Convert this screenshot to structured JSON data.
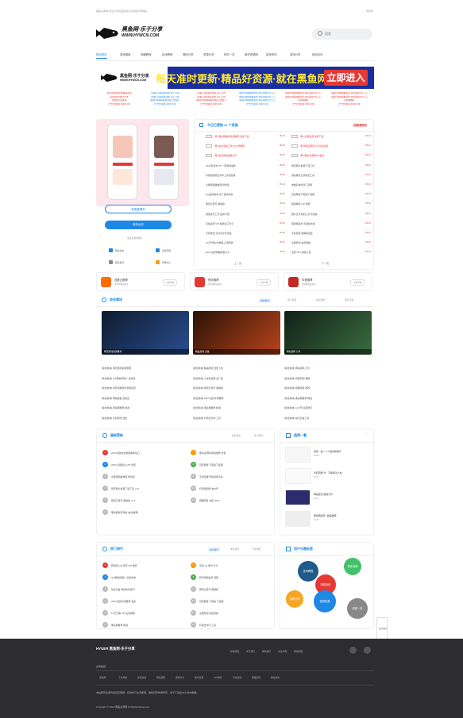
{
  "topbar": {
    "left": "黑鱼资源网-专注分享优质资源与实用技巧的网站",
    "right": "手机版"
  },
  "logo": {
    "brand": "黑鱼网·乐于分享",
    "url": "WWW.HYWCN.COM"
  },
  "search": {
    "placeholder": "搜索"
  },
  "nav": [
    "网站首页",
    "游戏模板",
    "网赚教程",
    "技术教程",
    "源码分享",
    "资源分享",
    "软件一览",
    "素材资源网",
    "影视资讯",
    "游戏分享",
    "网站优化"
  ],
  "banner": {
    "text": "每天准时更新·精品好资源·就在黑鱼网",
    "button": "立即进入"
  },
  "adlinks": [
    [
      "黑鱼资源网[付费]精品资源",
      "[赞助] 全站资源免费 四人可用",
      "[赞助] 全站资源免费 四人可用",
      "[赞助] 网站模板免费 源码资源分享入口",
      "[赞助] 网站模板免费 源码资源分享入口",
      "[赞助] 网站模板免费 源码资源分享入口",
      "黑鱼网推荐",
      "优惠活动 折扣领取入口"
    ],
    [
      "黑鱼网VIP会员年卡",
      "[赞助] 全站资源免费 四人可用",
      "[赞助] 全站资源免费 四人可用",
      "[赞助] 网站模板免费 源码资源分享入口",
      "[赞助] 网站模板免费 源码资源分享入口",
      "[赞助] 网站模板免费 源码资源分享入口",
      "黑鱼网推荐",
      "优惠活动 折扣领取入口"
    ],
    [
      "全网最大资源站",
      "[赞助] 网站模板资源站 点击进入",
      "[赞助] 网站模板资源站 点击进入",
      "[赞助] 网站模板免费 源码资源分享入口",
      "黑鱼网推荐",
      "黑鱼网推荐",
      "优惠活动 折扣领取入口",
      "优惠活动 折扣领取入口"
    ],
    [
      "[广告位]招租 3000元/年",
      "[广告位]招租 3000元/年",
      "[广告位]招租 3000元/年",
      "[广告位]招租 3000元/年",
      "[广告位]招租 3000元/年",
      "[广告位]招租 3000元/年",
      "[广告位]招租 3000元/年",
      "[广告位]招租 3000元/年"
    ]
  ],
  "sidebar_left": {
    "btn_login": "我是管理员",
    "btn_coop": "商务合作",
    "sub_label": "黑鱼资源网服务",
    "links": [
      "网站优化",
      "投稿须知",
      "联系我们",
      "招聘中心"
    ]
  },
  "today": {
    "title": "今日已更新 21 个资源",
    "more": "投稿请联系",
    "left": [
      {
        "text": "[荐] 黑鱼网精选资源推荐 合集下载",
        "date": "05-01",
        "red": true
      },
      {
        "text": "[荐] 站长必备工具大全 附教程",
        "date": "05-01",
        "red": true
      },
      {
        "text": "[荐] 最新网站模板分享",
        "date": "05-01",
        "red": true
      },
      {
        "text": "2020年最新 PS 一键调色插件",
        "date": "05-01",
        "red": false
      },
      {
        "text": "抖音短视频去水印工具免费版",
        "date": "05-01",
        "red": false
      },
      {
        "text": "全能视频播放器 绿色版",
        "date": "05-01",
        "red": false
      },
      {
        "text": "QQ最新版本 去广告纯净版",
        "date": "05-01",
        "red": false
      },
      {
        "text": "网易云音乐 解锁版",
        "date": "05-01",
        "red": false
      },
      {
        "text": "微信多开工具 最新可用",
        "date": "05-01",
        "red": false
      },
      {
        "text": "某站资源 VIP 解析接口分享",
        "date": "05-01",
        "red": false
      },
      {
        "text": "手机壁纸 高清无水印合集",
        "date": "05-01",
        "red": false
      },
      {
        "text": "10元开通VIP教程 亲测有效",
        "date": "05-01",
        "red": false
      },
      {
        "text": "2020 最新网赚项目分享",
        "date": "05-01",
        "red": false
      }
    ],
    "right": [
      {
        "text": "[荐] 全网资源 免费下载",
        "date": "05-01",
        "red": true
      },
      {
        "text": "[荐] 精品源码分享 站长必备",
        "date": "05-01",
        "red": true
      },
      {
        "text": "[荐] 黑鱼资源网VIP会员",
        "date": "05-01",
        "red": true
      },
      {
        "text": "网页图片批量下载工具",
        "date": "05-01",
        "red": false
      },
      {
        "text": "微信聊天记录恢复工具",
        "date": "05-01",
        "red": false
      },
      {
        "text": "电脑系统优化工具箱",
        "date": "05-01",
        "red": false
      },
      {
        "text": "百度网盘不限速下载器",
        "date": "05-01",
        "red": false
      },
      {
        "text": "超级解析 VIP 视频",
        "date": "05-01",
        "red": false
      },
      {
        "text": "图片文字识别工具 离线版",
        "date": "05-01",
        "red": false
      },
      {
        "text": "短视频素材 无版权合集",
        "date": "05-01",
        "red": false
      },
      {
        "text": "手机游戏 破解版合集",
        "date": "05-01",
        "red": false
      },
      {
        "text": "全网影视 免费观看",
        "date": "05-01",
        "red": false
      },
      {
        "text": "免费 PPT 模板下载",
        "date": "05-01",
        "red": false
      }
    ],
    "prev": "上一页",
    "next": "下一页"
  },
  "apps": [
    {
      "name": "百度云推荐",
      "sub": "黑鱼网精选推荐",
      "btn": "立即查看"
    },
    {
      "name": "快手推荐",
      "sub": "黑鱼网精选推荐",
      "btn": "立即查看"
    },
    {
      "name": "抖音推荐",
      "sub": "黑鱼网精选推荐",
      "btn": "立即查看"
    }
  ],
  "featured": {
    "title": "综合模块",
    "tabs": [
      "精选推荐",
      "热门资源",
      "最新发布",
      "更多分类"
    ],
    "thumbs": [
      "网页游戏资源推荐",
      "精品游戏 合集",
      "网站源码 分享"
    ],
    "cols": [
      [
        "[综合模块] 网页游戏资源推荐",
        "[综合模块] QQ群发机器人 最新版",
        "[综合模块] 免费领取腾讯视频会员",
        "[综合模块] 网站模板 自适应",
        "[综合模块] 黑鱼网推荐 精选",
        "[综合模块] 手机游戏 合集"
      ],
      [
        "[综合模块] 精品游戏 合集下载",
        "[综合模块] 小说阅读器 去广告",
        "[综合模块] 网易云音乐 解锁版",
        "[综合模块] 2020 最新手游推荐",
        "[综合模块] 黑鱼网推荐 精选",
        "[综合模块] 抖音去水印 工具"
      ],
      [
        "[综合模块] 网站源码 分享",
        "[综合模块] 视频剪辑 教程",
        "[综合模块] 网赚项目 推荐",
        "[综合模块] 黑鱼网推荐 精选",
        "[综合模块] 公众号 运营技巧",
        "[综合模块] 站长必备工具"
      ]
    ]
  },
  "latest": {
    "title": "最新更新",
    "tabs": [
      "最新更新",
      "热门推荐"
    ],
    "left": [
      "2020 最新在线视频解析接口",
      "2020 全网最全 VIP 影视",
      "全能视频播放器 绿色版",
      "网页图片批量下载工具 v2.0",
      "网易云音乐 解锁版 v1.5",
      "黑鱼网资源导航 [站长推荐]"
    ],
    "right": [
      "黑鱼资源网 精选推荐 合集",
      "百度网盘 不限速下载器",
      "王者荣耀 皮肤领取活动",
      "抖音短视频 去水印",
      "网赚项目 合集 2020"
    ]
  },
  "recommend": {
    "title": "值得一看",
    "items": [
      {
        "text": "自律，是一个人最好的修行",
        "date": "02-28"
      },
      {
        "text": "手机流量 卡，不够用怎么办",
        "date": "02-27"
      },
      {
        "text": "网站优化 经验分享",
        "date": "02-27"
      },
      {
        "text": "黑鱼网资源 · 精品推荐",
        "date": "02-18"
      }
    ]
  },
  "hot": {
    "title": "热门排行",
    "tabs": [
      "本周排行",
      "本月排行",
      "年度排行"
    ],
    "left": [
      "网页版 QQ 音乐 VIP 解析",
      "QQ群发机器人 最新版本",
      "站长必备 网站优化技巧",
      "2020 最新手游推荐 合集",
      "10元开通 VIP 会员教程",
      "黑鱼网推荐 精选"
    ],
    "right": [
      "迅雷 vip 账号 分享",
      "腾讯视频会员 领取",
      "网易云音乐 解锁版",
      "百度网盘 不限速 下载器",
      "全网影视 免费观看",
      "抖音去水印 工具"
    ]
  },
  "tags": {
    "title": "用户兴趣标签",
    "bubbles": [
      "技术教程",
      "软件资源",
      "网站优化",
      "游戏分享",
      "影视资源",
      "资源一览"
    ]
  },
  "floatbtn": "返回顶部",
  "footer": {
    "brand": "HYUER 黑鱼网·乐于分享",
    "links_label": "友情链接：",
    "links": [
      "黑鱼网",
      "工具导航",
      "优质资源",
      "网站源码",
      "源码分享",
      "软件资源",
      "VIP视频",
      "手机游戏",
      "网赚项目",
      "网站优化"
    ],
    "top_links": [
      "投稿须知",
      "关于我们",
      "联系我们",
      "免责声明",
      "网站地图"
    ],
    "disclaimer": "本站所有资源均来自互联网，仅供学习交流使用，版权归原作者所有，请于下载后24小时内删除。",
    "copyright": "Copyright © 2020 黑鱼资源网 All Rights Reserved."
  },
  "colors": {
    "accent": "#1e88e5",
    "red": "#e53935",
    "banner_bg": "#1a2e9e",
    "banner_text": "#ffe92f",
    "footer_bg": "#2d2d30"
  }
}
